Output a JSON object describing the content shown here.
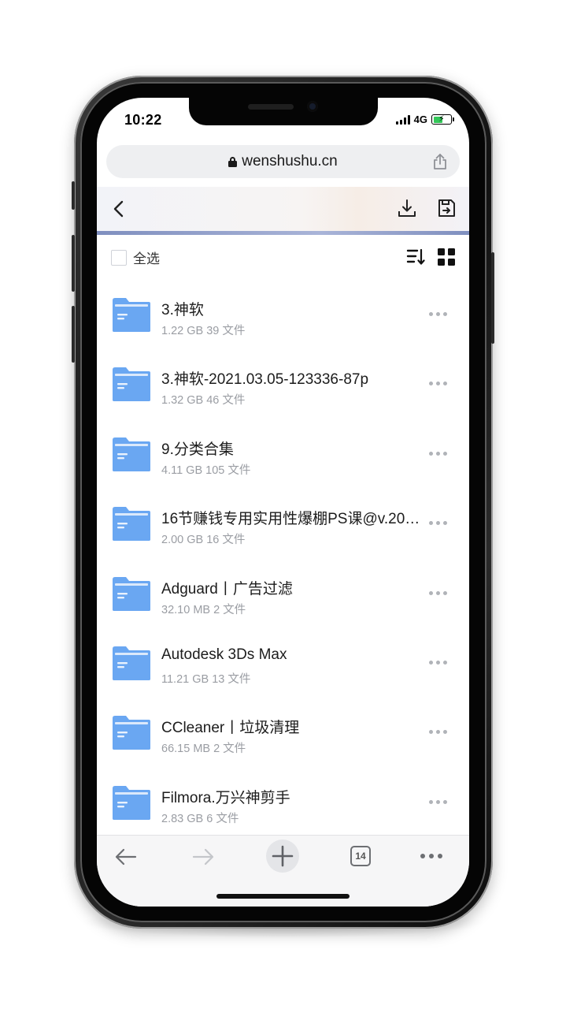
{
  "status_bar": {
    "time": "10:22",
    "network": "4G",
    "battery_fraction": 0.55,
    "charging": true
  },
  "address_bar": {
    "url": "wenshushu.cn",
    "lock_icon": "lock-icon",
    "share_icon": "share-icon"
  },
  "header": {
    "back_icon": "chevron-left-icon",
    "download_icon": "download-icon",
    "save_icon": "save-icon"
  },
  "toolbar": {
    "select_all_label": "全选",
    "sort_icon": "sort-icon",
    "grid_icon": "grid-view-icon"
  },
  "files": [
    {
      "name": "3.神软",
      "meta": "1.22 GB 39 文件"
    },
    {
      "name": "3.神软-2021.03.05-123336-87p",
      "meta": "1.32 GB 46 文件"
    },
    {
      "name": "9.分类合集",
      "meta": "4.11 GB 105 文件"
    },
    {
      "name": "16节赚钱专用实用性爆棚PS课@v.20…",
      "meta": "2.00 GB 16 文件"
    },
    {
      "name": "Adguard丨广告过滤",
      "meta": "32.10 MB 2 文件"
    },
    {
      "name": "Autodesk 3Ds Max",
      "meta": "11.21 GB 13 文件"
    },
    {
      "name": "CCleaner丨垃圾清理",
      "meta": "66.15 MB 2 文件"
    },
    {
      "name": "Filmora.万兴神剪手",
      "meta": "2.83 GB 6 文件"
    }
  ],
  "bottom_bar": {
    "tab_count": "14",
    "back_icon": "arrow-left-icon",
    "forward_icon": "arrow-right-icon",
    "new_tab_icon": "plus-icon",
    "menu_icon": "more-icon"
  },
  "colors": {
    "folder_blue": "#6aa7f2",
    "folder_light": "#dbe9fb",
    "accent_stripe": "#8a98c8",
    "battery_green": "#34c759"
  }
}
